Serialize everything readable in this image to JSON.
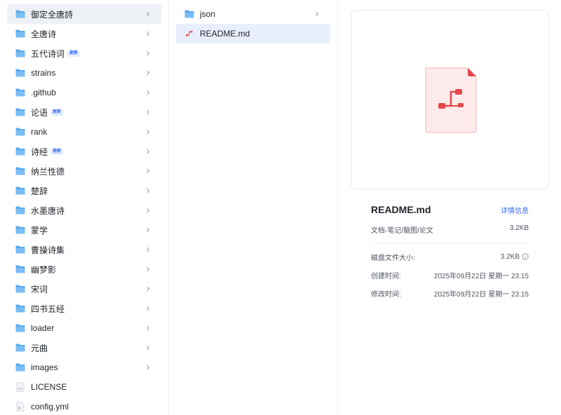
{
  "column1": {
    "items": [
      {
        "type": "folder",
        "name": "御定全唐詩",
        "badge": "",
        "selected": true
      },
      {
        "type": "folder",
        "name": "全唐诗",
        "badge": ""
      },
      {
        "type": "folder",
        "name": "五代诗词",
        "badge": "更新"
      },
      {
        "type": "folder",
        "name": "strains",
        "badge": ""
      },
      {
        "type": "folder",
        "name": ".github",
        "badge": ""
      },
      {
        "type": "folder",
        "name": "论语",
        "badge": "更新"
      },
      {
        "type": "folder",
        "name": "rank",
        "badge": ""
      },
      {
        "type": "folder",
        "name": "诗经",
        "badge": "更新"
      },
      {
        "type": "folder",
        "name": "纳兰性德",
        "badge": ""
      },
      {
        "type": "folder",
        "name": "楚辞",
        "badge": ""
      },
      {
        "type": "folder",
        "name": "水墨唐诗",
        "badge": ""
      },
      {
        "type": "folder",
        "name": "蒙学",
        "badge": ""
      },
      {
        "type": "folder",
        "name": "曹操诗集",
        "badge": ""
      },
      {
        "type": "folder",
        "name": "幽梦影",
        "badge": ""
      },
      {
        "type": "folder",
        "name": "宋词",
        "badge": ""
      },
      {
        "type": "folder",
        "name": "四书五经",
        "badge": ""
      },
      {
        "type": "folder",
        "name": "loader",
        "badge": ""
      },
      {
        "type": "folder",
        "name": "元曲",
        "badge": ""
      },
      {
        "type": "folder",
        "name": "images",
        "badge": ""
      },
      {
        "type": "txt",
        "name": "LICENSE",
        "badge": ""
      },
      {
        "type": "yml",
        "name": "config.yml",
        "badge": ""
      }
    ]
  },
  "column2": {
    "items": [
      {
        "type": "folder",
        "name": "json"
      },
      {
        "type": "md",
        "name": "README.md",
        "active": true
      }
    ]
  },
  "details": {
    "title": "README.md",
    "link_label": "详情信息",
    "type_label": "文档-笔记/脑图/论文",
    "size_short": "3.2KB",
    "disk_size_label": "磁盘文件大小:",
    "disk_size_value": "3.2KB",
    "created_label": "创建时间:",
    "created_value": "2025年09月22日 星期一 23:15",
    "modified_label": "修改时间:",
    "modified_value": "2025年09月22日 星期一 23:15"
  },
  "colors": {
    "folder_blue": "#5aa9ec",
    "accent_blue": "#3a6ff0",
    "markdown_red": "#e5484d"
  }
}
